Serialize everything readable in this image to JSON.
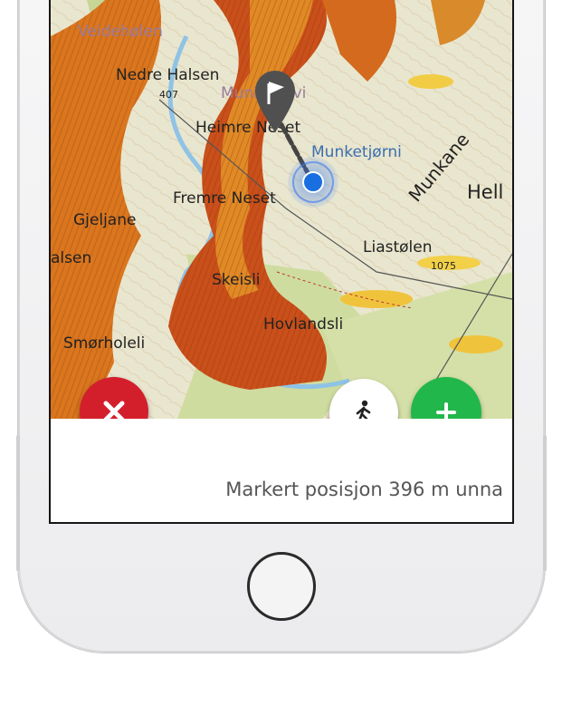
{
  "map": {
    "labels": {
      "veidehølen": "Veidehølen",
      "nedre_halsen": "Nedre Halsen",
      "elev_407": "407",
      "munketrovi": "Munketrovi",
      "heimre_neset": "Heimre Neset",
      "munketjorni": "Munketjørni",
      "munkane": "Munkane",
      "hell": "Hell",
      "fremre_neset": "Fremre Neset",
      "gjeljane": "Gjeljane",
      "liastolen": "Liastølen",
      "elev_1075": "1075",
      "alsen": "alsen",
      "skeisli": "Skeisli",
      "hovlandsli": "Hovlandsli",
      "smorholeli": "Smørholeli"
    }
  },
  "status": {
    "text": "Markert posisjon 396 m unna"
  },
  "colors": {
    "cancel": "#d31f2c",
    "add": "#22b74a",
    "location": "#1a6fe0"
  },
  "icons": {
    "cancel": "close-icon",
    "walk": "walking-person-icon",
    "add": "plus-icon",
    "marker": "flag-marker-icon"
  }
}
